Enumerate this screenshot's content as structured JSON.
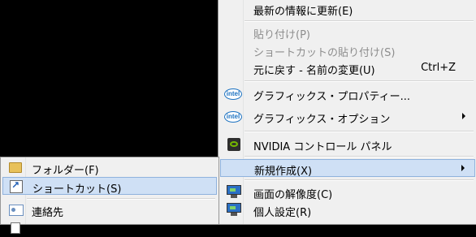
{
  "context_menu": {
    "items": [
      {
        "label": "最新の情報に更新(E)",
        "disabled": false
      },
      {
        "label": "貼り付け(P)",
        "disabled": true
      },
      {
        "label": "ショートカットの貼り付け(S)",
        "disabled": true
      },
      {
        "label": "元に戻す - 名前の変更(U)",
        "shortcut": "Ctrl+Z",
        "disabled": false
      },
      {
        "label": "グラフィックス・プロパティー...",
        "icon": "intel-icon"
      },
      {
        "label": "グラフィックス・オプション",
        "icon": "intel-icon",
        "submenu": true
      },
      {
        "label": "NVIDIA コントロール パネル",
        "icon": "nvidia-icon"
      },
      {
        "label": "新規作成(X)",
        "submenu": true,
        "highlighted": true
      },
      {
        "label": "画面の解像度(C)",
        "icon": "monitor-icon"
      },
      {
        "label": "個人設定(R)",
        "icon": "monitor-icon"
      }
    ],
    "intel_logo_text": "intel"
  },
  "new_submenu": {
    "items": [
      {
        "label": "フォルダー(F)",
        "icon": "folder-icon"
      },
      {
        "label": "ショートカット(S)",
        "icon": "shortcut-icon",
        "highlighted": true
      },
      {
        "label": "連絡先",
        "icon": "contact-icon"
      }
    ]
  },
  "colors": {
    "menu_bg": "#f0f0f0",
    "highlight_bg": "#cfe0f5",
    "highlight_border": "#8fb2dd",
    "disabled_text": "#8d8d8d",
    "desktop_bg": "#000000"
  }
}
